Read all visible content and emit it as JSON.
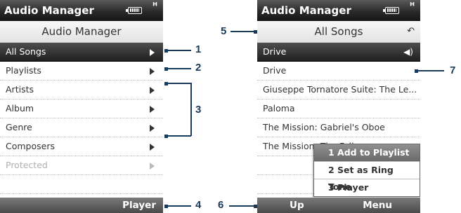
{
  "left_screen": {
    "title": "Audio Manager",
    "header": "Audio Manager",
    "items": [
      {
        "label": "All Songs"
      },
      {
        "label": "Playlists"
      },
      {
        "label": "Artists"
      },
      {
        "label": "Album"
      },
      {
        "label": "Genre"
      },
      {
        "label": "Composers"
      },
      {
        "label": "Protected"
      }
    ],
    "softkey_right": "Player"
  },
  "right_screen": {
    "title": "Audio Manager",
    "header": "All Songs",
    "songs": [
      {
        "label": "Drive"
      },
      {
        "label": "Drive"
      },
      {
        "label": "Giuseppe Tornatore Suite: The Le..."
      },
      {
        "label": "Paloma"
      },
      {
        "label": "The Mission: Gabriel's Oboe"
      },
      {
        "label": "The Mission: The Falls"
      }
    ],
    "menu": [
      {
        "label": "1 Add to Playlist"
      },
      {
        "label": "2 Set as Ring Tone"
      },
      {
        "label": "3 Player"
      }
    ],
    "softkey_left": "Up",
    "softkey_right": "Menu"
  },
  "callouts": [
    "1",
    "2",
    "3",
    "4",
    "5",
    "6",
    "7"
  ]
}
